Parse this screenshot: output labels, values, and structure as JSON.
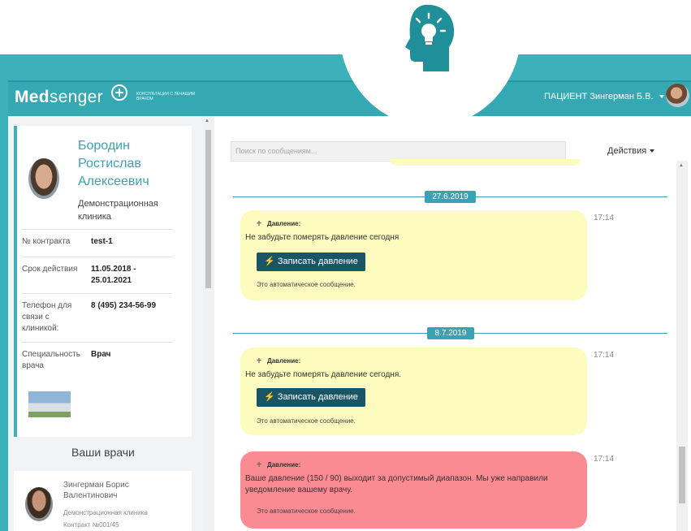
{
  "header": {
    "logo_prefix": "Med",
    "logo_suffix": "senger",
    "tagline": "КОНСУЛЬТАЦИИ С ЛЕЧАЩИМ ВРАЧОМ",
    "user_label": "ПАЦИЕНТ Зингерман Б.В."
  },
  "profile": {
    "name": "Бородин Ростислав Алексеевич",
    "clinic": "Демонстрационная клиника",
    "rows": [
      {
        "key": "№ контракта",
        "value": "test-1"
      },
      {
        "key": "Срок действия",
        "value": "11.05.2018 - 25.01.2021"
      },
      {
        "key": "Телефон для связи с клиникой:",
        "value": "8 (495) 234-56-99"
      },
      {
        "key": "Специальность врача",
        "value": "Врач"
      }
    ]
  },
  "your_doctors": {
    "heading": "Ваши врачи",
    "doctor_name": "Зингерман Борис Валентинович",
    "doctor_clinic": "Демонстрационная клиника",
    "doctor_contract": "Контракт №001/45"
  },
  "chat": {
    "search_placeholder": "Поиск по сообщениям...",
    "actions_label": "Действия",
    "dates": [
      "27.6.2019",
      "8.7.2019"
    ],
    "messages": [
      {
        "title": "Давление:",
        "text": "Не забудьте померять давление сегодня",
        "button": "Записать давление",
        "auto": "Это автоматическое сообщение.",
        "time": "17:14"
      },
      {
        "title": "Давление:",
        "text": "Не забудьте померять давление сегодня.",
        "button": "Записать давление",
        "auto": "Это автоматическое сообщение.",
        "time": "17:14"
      },
      {
        "title": "Давление:",
        "text": "Ваше давление (150 / 90) выходит за допустимый диапазон. Мы уже направили уведомление вашему врачу.",
        "auto": "Это автоматическое сообщение.",
        "time": "17:14"
      }
    ]
  },
  "colors": {
    "brand_teal": "#34a8b3",
    "message_yellow": "#fdfbbd",
    "message_red": "#fb8b93",
    "button_dark": "#1a5566"
  },
  "icons": [
    "lightbulb-head-icon",
    "logo-plus-icon",
    "chevron-down-icon",
    "blood-pressure-icon",
    "lightning-icon"
  ]
}
